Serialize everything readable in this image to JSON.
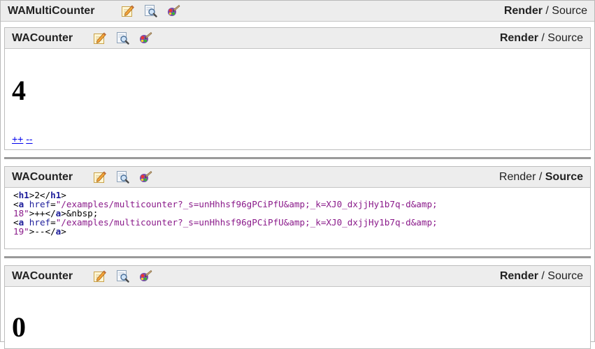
{
  "outer": {
    "title": "WAMultiCounter",
    "mode_render": "Render",
    "mode_sep": " / ",
    "mode_source": "Source",
    "active_mode": "render"
  },
  "components": [
    {
      "title": "WACounter",
      "mode_render": "Render",
      "mode_sep": " / ",
      "mode_source": "Source",
      "active_mode": "render",
      "value": "4",
      "increment_label": "++",
      "decrement_label": "--"
    },
    {
      "title": "WACounter",
      "mode_render": "Render",
      "mode_sep": " / ",
      "mode_source": "Source",
      "active_mode": "source",
      "source": {
        "l1_open": "<",
        "l1_tag1": "h1",
        "l1_mid": ">2</",
        "l1_tag2": "h1",
        "l1_close": ">",
        "l2_open": "<",
        "l2_tag": "a",
        "l2_space": " ",
        "l2_attr": "href",
        "l2_eq": "=",
        "l2_str": "\"/examples/multicounter?_s=unHhhsf96gPCiPfU&amp;_k=XJ0_dxjjHy1b7q-d&amp;",
        "l3_str": "18\"",
        "l3_text": ">++</",
        "l3_tag": "a",
        "l3_close": ">&nbsp;",
        "l4_open": "<",
        "l4_tag": "a",
        "l4_space": " ",
        "l4_attr": "href",
        "l4_eq": "=",
        "l4_str": "\"/examples/multicounter?_s=unHhhsf96gPCiPfU&amp;_k=XJ0_dxjjHy1b7q-d&amp;",
        "l5_str": "19\"",
        "l5_text": ">--</",
        "l5_tag": "a",
        "l5_close": ">"
      }
    },
    {
      "title": "WACounter",
      "mode_render": "Render",
      "mode_sep": " / ",
      "mode_source": "Source",
      "active_mode": "render",
      "value": "0"
    }
  ],
  "icons": [
    "edit-icon",
    "inspect-icon",
    "style-icon"
  ]
}
